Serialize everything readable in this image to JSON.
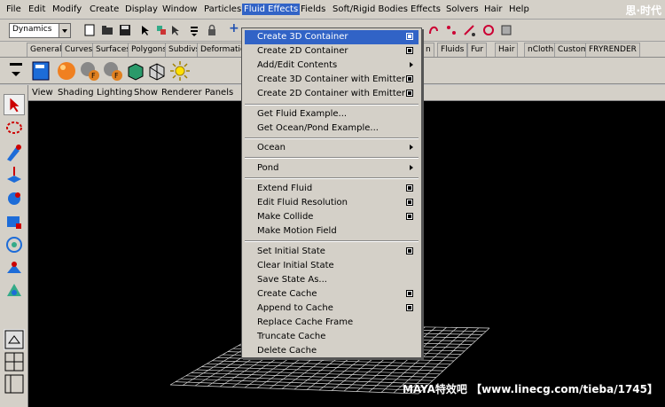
{
  "menubar": [
    "File",
    "Edit",
    "Modify",
    "Create",
    "Display",
    "Window",
    "Particles",
    "Fluid Effects",
    "Fields",
    "Soft/Rigid Bodies",
    "Effects",
    "Solvers",
    "Hair",
    "Help"
  ],
  "menuset": "Dynamics",
  "shelf_tabs": [
    "General",
    "Curves",
    "Surfaces",
    "Polygons",
    "Subdivs",
    "Deformation",
    "n",
    "Fluids",
    "Fur",
    "Hair",
    "nCloth",
    "Custom",
    "FRYRENDER"
  ],
  "panel_menu": [
    "View",
    "Shading",
    "Lighting",
    "Show",
    "Renderer",
    "Panels"
  ],
  "fluid_menu": {
    "items": [
      {
        "label": "Create 3D Container",
        "option": true
      },
      {
        "label": "Create 2D Container",
        "option": true
      },
      {
        "label": "Add/Edit Contents",
        "submenu": true
      },
      {
        "label": "Create 3D Container with Emitter",
        "option": true
      },
      {
        "label": "Create 2D Container with Emitter",
        "option": true
      },
      {
        "label": "Get Fluid Example..."
      },
      {
        "label": "Get Ocean/Pond Example..."
      },
      {
        "label": "Ocean",
        "submenu": true
      },
      {
        "label": "Pond",
        "submenu": true
      },
      {
        "label": "Extend Fluid",
        "option": true
      },
      {
        "label": "Edit Fluid Resolution",
        "option": true
      },
      {
        "label": "Make Collide",
        "option": true
      },
      {
        "label": "Make Motion Field"
      },
      {
        "label": "Set Initial State",
        "option": true
      },
      {
        "label": "Clear Initial State"
      },
      {
        "label": "Save State As..."
      },
      {
        "label": "Create Cache",
        "option": true
      },
      {
        "label": "Append to Cache",
        "option": true
      },
      {
        "label": "Replace Cache Frame"
      },
      {
        "label": "Truncate Cache"
      },
      {
        "label": "Delete Cache"
      }
    ],
    "highlighted_index": 0
  },
  "watermark": "MAYA特效吧 【www.linecg.com/tieba/1745】",
  "logo": "思·时代",
  "colors": {
    "highlight": "#3163c6",
    "panel": "#d4d0c8",
    "viewport": "#000000"
  }
}
